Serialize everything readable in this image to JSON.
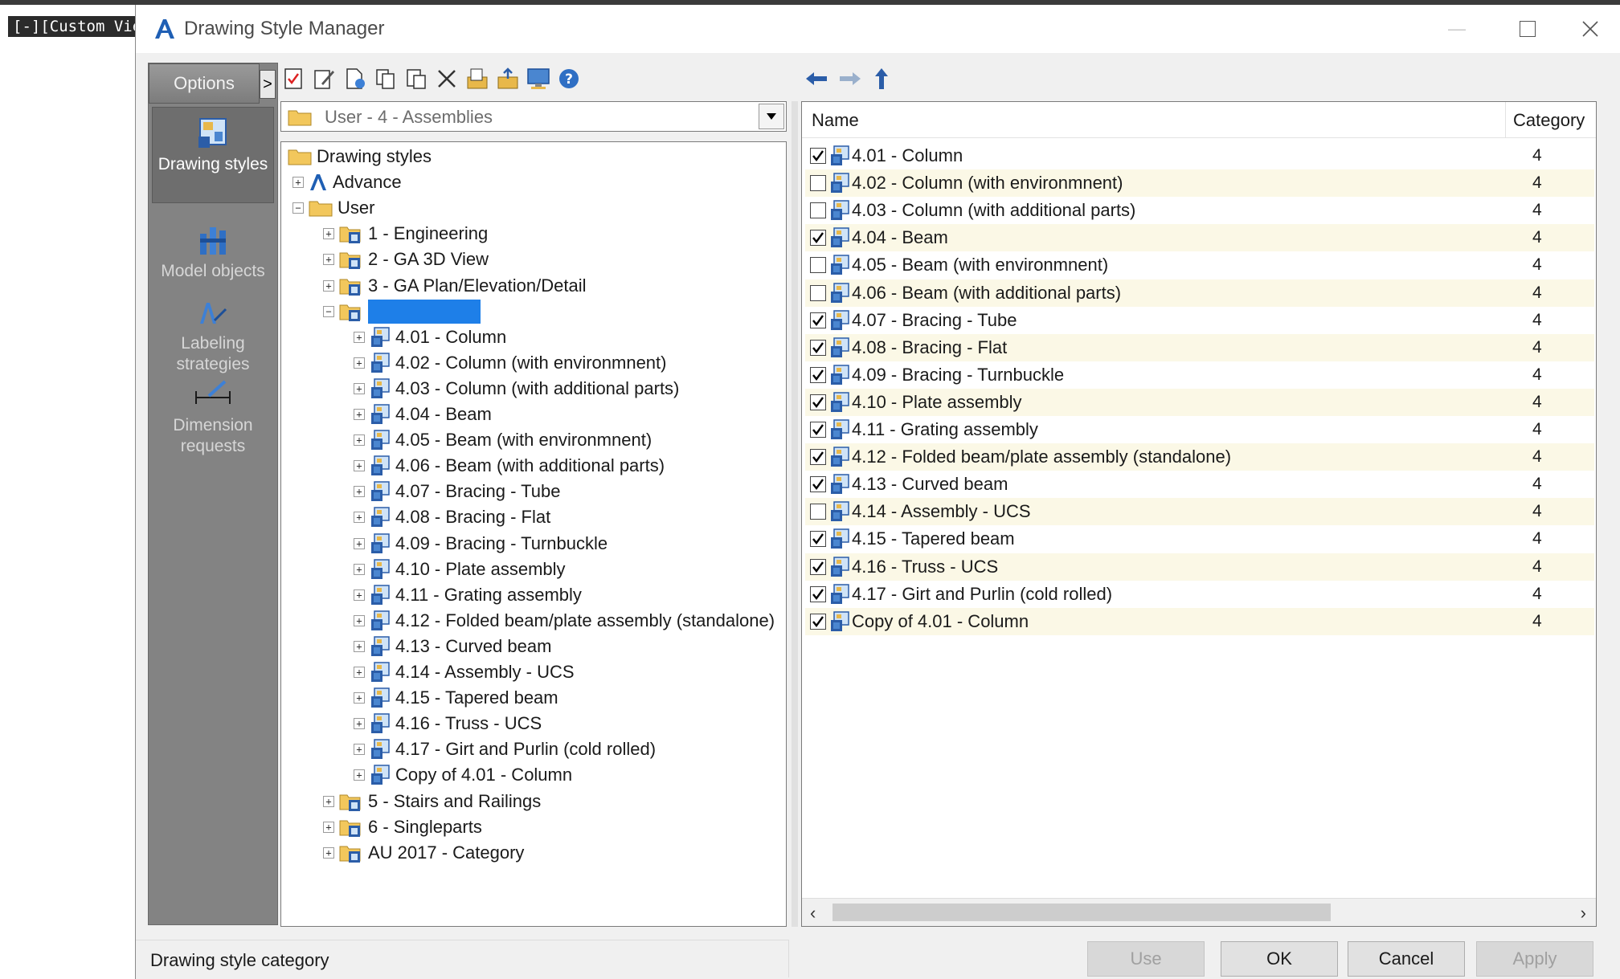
{
  "background": {
    "viewport_tab": "[-][Custom View"
  },
  "window": {
    "title": "Drawing Style Manager"
  },
  "sidebar": {
    "options_label": "Options",
    "options_arrow": ">",
    "items": [
      {
        "label": "Drawing styles",
        "active": true
      },
      {
        "label": "Model objects"
      },
      {
        "label": "Labeling strategies"
      },
      {
        "label": "Dimension requests"
      }
    ]
  },
  "combo": {
    "value": "User - 4 - Assemblies"
  },
  "tree": {
    "root": "Drawing styles",
    "advance": "Advance",
    "user": "User",
    "categories": [
      "1 - Engineering",
      "2 - GA 3D View",
      "3 - GA Plan/Elevation/Detail"
    ],
    "children": [
      "4.01 - Column",
      "4.02 - Column (with environmnent)",
      "4.03 - Column (with additional parts)",
      "4.04 - Beam",
      "4.05 - Beam (with environmnent)",
      "4.06 - Beam (with additional parts)",
      "4.07 - Bracing - Tube",
      "4.08 - Bracing - Flat",
      "4.09 - Bracing - Turnbuckle",
      "4.10 - Plate assembly",
      "4.11 - Grating assembly",
      "4.12 - Folded beam/plate assembly (standalone)",
      "4.13 - Curved beam",
      "4.14 - Assembly - UCS",
      "4.15 - Tapered beam",
      "4.16 - Truss - UCS",
      "4.17 - Girt and Purlin (cold rolled)",
      "Copy of 4.01 - Column"
    ],
    "after": [
      "5 - Stairs and Railings",
      "6 - Singleparts",
      "AU 2017 - Category"
    ]
  },
  "list": {
    "col_name": "Name",
    "col_category": "Category",
    "rows": [
      {
        "name": "4.01 - Column",
        "category": "4",
        "checked": true
      },
      {
        "name": "4.02 - Column (with environmnent)",
        "category": "4",
        "checked": false
      },
      {
        "name": "4.03 - Column (with additional parts)",
        "category": "4",
        "checked": false
      },
      {
        "name": "4.04 - Beam",
        "category": "4",
        "checked": true
      },
      {
        "name": "4.05 - Beam (with environmnent)",
        "category": "4",
        "checked": false
      },
      {
        "name": "4.06 - Beam (with additional parts)",
        "category": "4",
        "checked": false
      },
      {
        "name": "4.07 - Bracing - Tube",
        "category": "4",
        "checked": true
      },
      {
        "name": "4.08 - Bracing - Flat",
        "category": "4",
        "checked": true
      },
      {
        "name": "4.09 - Bracing - Turnbuckle",
        "category": "4",
        "checked": true
      },
      {
        "name": "4.10 - Plate assembly",
        "category": "4",
        "checked": true
      },
      {
        "name": "4.11 - Grating assembly",
        "category": "4",
        "checked": true
      },
      {
        "name": "4.12 - Folded beam/plate assembly (standalone)",
        "category": "4",
        "checked": true
      },
      {
        "name": "4.13 - Curved beam",
        "category": "4",
        "checked": true
      },
      {
        "name": "4.14 - Assembly - UCS",
        "category": "4",
        "checked": false
      },
      {
        "name": "4.15 - Tapered beam",
        "category": "4",
        "checked": true
      },
      {
        "name": "4.16 - Truss - UCS",
        "category": "4",
        "checked": true
      },
      {
        "name": "4.17 - Girt and Purlin (cold rolled)",
        "category": "4",
        "checked": true
      },
      {
        "name": "Copy of 4.01 - Column",
        "category": "4",
        "checked": true
      }
    ]
  },
  "status": {
    "text": "Drawing style category"
  },
  "buttons": {
    "use": "Use",
    "ok": "OK",
    "cancel": "Cancel",
    "apply": "Apply"
  },
  "colors": {
    "selection": "#1e7fe8",
    "sidebar": "#838383",
    "alt_row": "#fbf8e6",
    "folder": "#e8b84a"
  }
}
